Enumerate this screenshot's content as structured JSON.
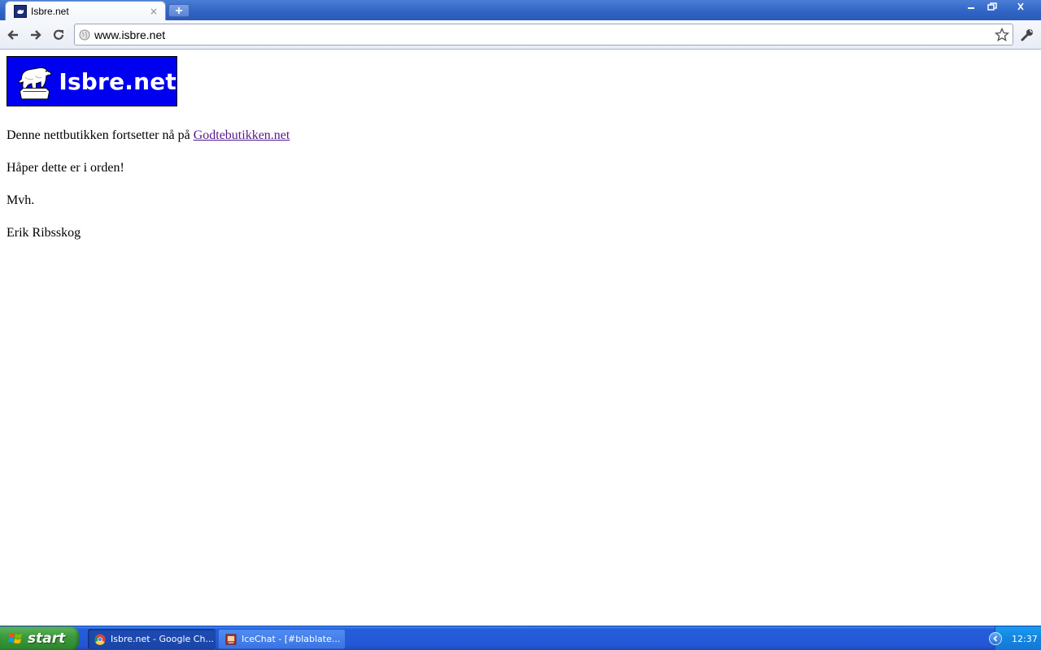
{
  "browser": {
    "tab_title": "Isbre.net",
    "tab_close": "×",
    "url": "www.isbre.net"
  },
  "page": {
    "logo_text": "Isbre.net",
    "line1_text": "Denne nettbutikken fortsetter nå på ",
    "line1_link": "Godtebutikken.net",
    "line2": "Håper dette er i orden!",
    "line3": "Mvh.",
    "line4": "Erik Ribsskog"
  },
  "taskbar": {
    "start_label": "start",
    "items": [
      {
        "label": "Isbre.net - Google Ch...",
        "icon": "chrome-icon",
        "active": true
      },
      {
        "label": "IceChat - [#blablate...",
        "icon": "icechat-icon",
        "active": false
      }
    ],
    "clock": "12:37"
  },
  "colors": {
    "logo_bg": "#0000f0",
    "link_visited": "#551a8b",
    "taskbar": "#245edb",
    "start_green": "#3c9b3c"
  }
}
